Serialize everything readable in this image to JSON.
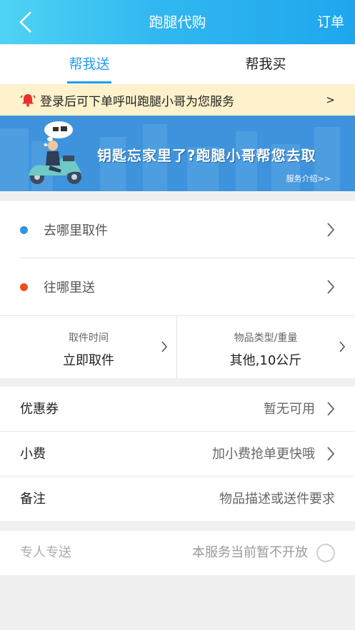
{
  "header": {
    "title": "跑腿代购",
    "orders_label": "订单",
    "back_icon": "chevron-left-icon"
  },
  "tabs": [
    {
      "label": "帮我送",
      "active": true
    },
    {
      "label": "帮我买",
      "active": false
    }
  ],
  "notice": {
    "icon": "bell-icon",
    "text": "登录后可下单呼叫跑腿小哥为您服务",
    "arrow": ">"
  },
  "banner": {
    "headline": "钥匙忘家里了?跑腿小哥帮您去取",
    "link": "服务介绍>>"
  },
  "address": {
    "pickup_label": "去哪里取件",
    "deliver_label": "往哪里送"
  },
  "pickup_info": {
    "time": {
      "caption": "取件时间",
      "value": "立即取件"
    },
    "item": {
      "caption": "物品类型/重量",
      "value": "其他,10公斤"
    }
  },
  "options": [
    {
      "key": "优惠券",
      "value": "暂无可用",
      "chevron": true
    },
    {
      "key": "小费",
      "value": "加小费抢单更快哦",
      "chevron": true
    },
    {
      "key": "备注",
      "value": "物品描述或送件要求",
      "chevron": false
    }
  ],
  "exclusive": {
    "label": "专人专送",
    "status": "本服务当前暂不开放",
    "checked": false
  },
  "colors": {
    "accent": "#1f9cec",
    "notice_bg": "#fdf2cc",
    "banner_bg": "#3e93dc",
    "pickup_dot": "#2d94e8",
    "deliver_dot": "#f04f17"
  }
}
